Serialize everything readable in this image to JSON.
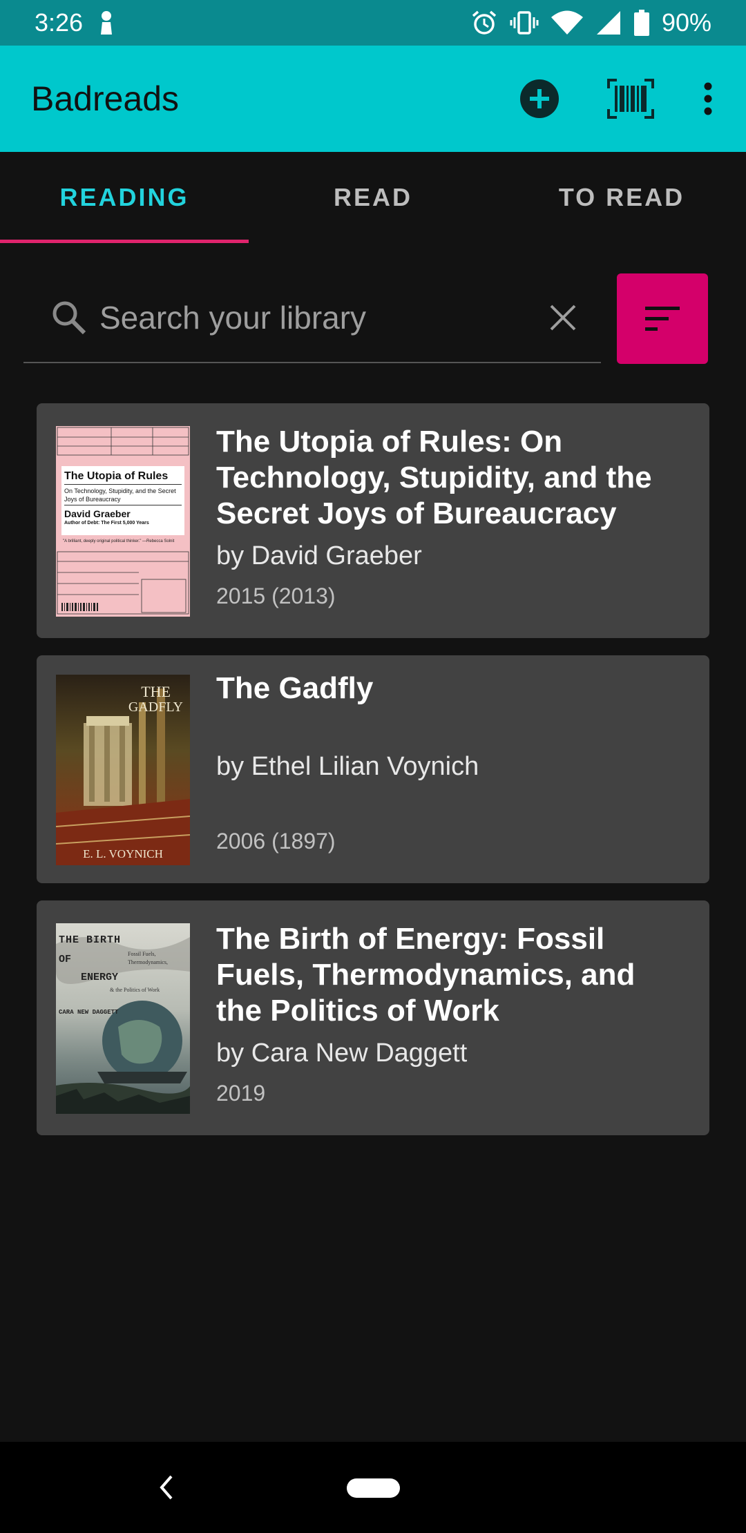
{
  "status_bar": {
    "time": "3:26",
    "battery": "90%",
    "icons": [
      "notification-icon",
      "alarm-icon",
      "vibrate-icon",
      "wifi-icon",
      "signal-icon",
      "battery-icon"
    ]
  },
  "app_bar": {
    "title": "Badreads",
    "actions": [
      "add-icon",
      "barcode-icon",
      "more-vert-icon"
    ],
    "color": "#00c8cc"
  },
  "tabs": [
    {
      "label": "READING",
      "active": true
    },
    {
      "label": "READ",
      "active": false
    },
    {
      "label": "TO READ",
      "active": false
    }
  ],
  "search": {
    "placeholder": "Search your library",
    "value": ""
  },
  "books": [
    {
      "title": "The Utopia of Rules: On Technology, Stupidity, and the Secret Joys of Bureaucracy",
      "author": "by David Graeber",
      "year": "2015 (2013)",
      "cover": {
        "title": "The Utopia of Rules",
        "subtitle": "On Technology, Stupidity, and the Secret Joys of Bureaucracy",
        "author": "David Graeber",
        "tagline": "Author of Debt: The First 5,000 Years",
        "quote": "\"A brilliant, deeply original political thinker.\" —Rebecca Solnit"
      }
    },
    {
      "title": "The Gadfly",
      "author": "by Ethel Lilian Voynich",
      "year": "2006 (1897)",
      "cover": {
        "title_line1": "THE",
        "title_line2": "GADFLY",
        "author": "E. L. VOYNICH"
      }
    },
    {
      "title": "The Birth of Energy: Fossil Fuels, Thermodynamics, and the Politics of Work",
      "author": "by Cara New Daggett",
      "year": "2019",
      "cover": {
        "line1": "THE BIRTH",
        "line2": "OF",
        "line3": "ENERGY",
        "sub1": "Fossil Fuels,",
        "sub2": "Thermodynamics,",
        "sub3": "& the Politics of Work",
        "author": "CARA NEW DAGGETT"
      }
    }
  ],
  "colors": {
    "accent": "#d4006a",
    "tab_active": "#22d3dd",
    "card": "#424242",
    "background": "#121212"
  }
}
